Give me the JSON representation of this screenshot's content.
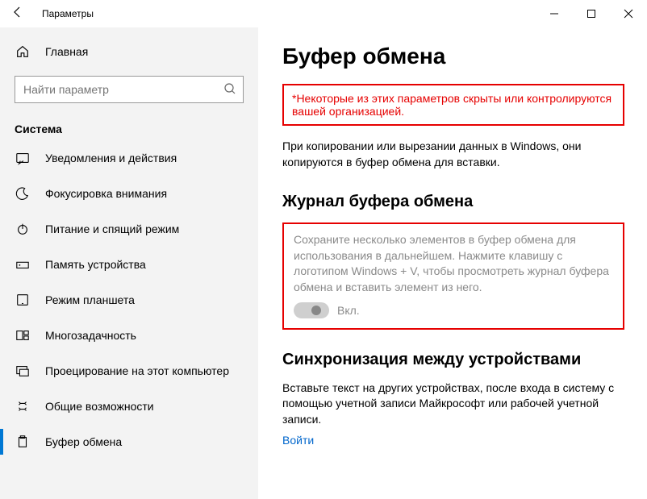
{
  "titlebar": {
    "title": "Параметры"
  },
  "sidebar": {
    "home": "Главная",
    "search_placeholder": "Найти параметр",
    "section": "Система",
    "items": [
      {
        "label": "Уведомления и действия"
      },
      {
        "label": "Фокусировка внимания"
      },
      {
        "label": "Питание и спящий режим"
      },
      {
        "label": "Память устройства"
      },
      {
        "label": "Режим планшета"
      },
      {
        "label": "Многозадачность"
      },
      {
        "label": "Проецирование на этот компьютер"
      },
      {
        "label": "Общие возможности"
      },
      {
        "label": "Буфер обмена"
      }
    ]
  },
  "content": {
    "page_title": "Буфер обмена",
    "org_notice": "*Некоторые из этих параметров скрыты или контролируются вашей организацией.",
    "copy_desc": "При копировании или вырезании данных в Windows, они копируются в буфер обмена для вставки.",
    "history_title": "Журнал буфера обмена",
    "history_desc": "Сохраните несколько элементов в буфер обмена для использования в дальнейшем. Нажмите клавишу с логотипом Windows + V, чтобы просмотреть журнал буфера обмена и вставить элемент из него.",
    "toggle_state": "Вкл.",
    "sync_title": "Синхронизация между устройствами",
    "sync_desc": "Вставьте текст на других устройствах, после входа в систему с помощью учетной записи Майкрософт или рабочей учетной записи.",
    "signin": "Войти"
  }
}
